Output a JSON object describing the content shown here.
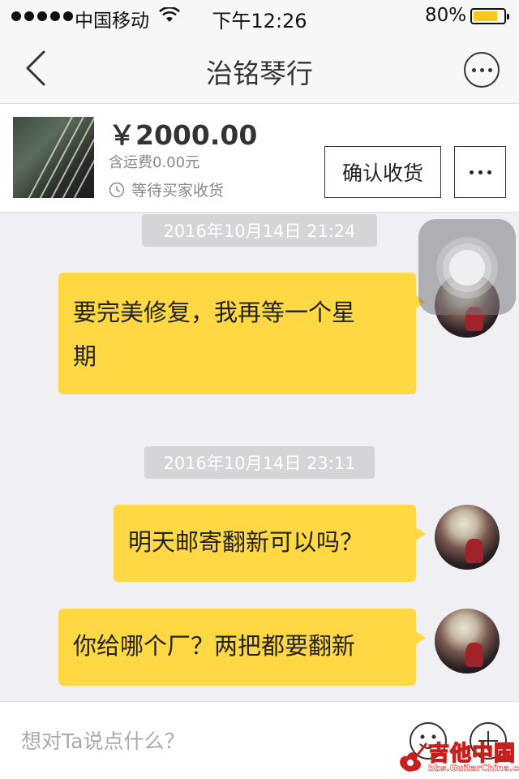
{
  "status_bar": {
    "carrier": "中国移动",
    "time": "下午12:26",
    "battery_percent": "80%",
    "battery_level": 0.8
  },
  "nav": {
    "title": "治铭琴行",
    "back_icon": "chevron-left-icon",
    "more_icon": "more-circle-icon"
  },
  "product": {
    "price": "￥2000.00",
    "shipping": "含运费0.00元",
    "status": "等待买家收货",
    "confirm_label": "确认收货",
    "more_label": "•••"
  },
  "messages": [
    {
      "timestamp": "2016年10月14日  21:24",
      "text": "要完美修复，我再等一个星\n期"
    },
    {
      "timestamp": "2016年10月14日  23:11",
      "text": "明天邮寄翻新可以吗？"
    },
    {
      "text": "你给哪个厂？两把都要翻新"
    }
  ],
  "input": {
    "placeholder": "想对Ta说点什么？"
  },
  "watermark": {
    "title": "吉他中国",
    "url": "bbs.GuitarChina.com"
  },
  "colors": {
    "bubble": "#ffd843",
    "background": "#efeff4",
    "timestamp_bg": "#d5d5d8"
  }
}
